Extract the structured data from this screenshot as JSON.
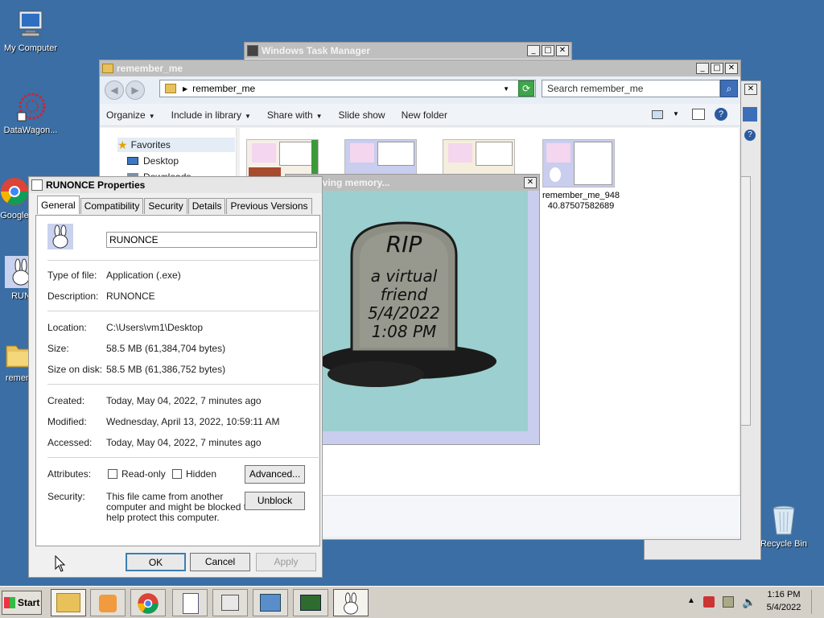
{
  "desktop": {
    "icons": [
      {
        "label": "My Computer"
      },
      {
        "label": "DataWagon..."
      },
      {
        "label": "Google"
      },
      {
        "label": "RUN"
      },
      {
        "label": "remem"
      },
      {
        "label": "Recycle Bin"
      }
    ]
  },
  "task_manager": {
    "title": "Windows Task Manager"
  },
  "explorer": {
    "title": "remember_me",
    "address": "remember_me",
    "search_placeholder": "Search remember_me",
    "commands": [
      {
        "label": "Organize"
      },
      {
        "label": "Include in library"
      },
      {
        "label": "Share with"
      },
      {
        "label": "Slide show"
      },
      {
        "label": "New folder"
      }
    ],
    "nav": {
      "favorites": "Favorites",
      "desktop": "Desktop",
      "downloads": "Downloads"
    },
    "file": {
      "name": "remember_me_948\n40.87507582689"
    }
  },
  "popup": {
    "title": "In loving memory...",
    "rip": "RIP",
    "line1": "a virtual",
    "line2": "friend",
    "date": "5/4/2022",
    "time": "1:08 PM"
  },
  "properties": {
    "title": "RUNONCE Properties",
    "tabs": [
      {
        "label": "General"
      },
      {
        "label": "Compatibility"
      },
      {
        "label": "Security"
      },
      {
        "label": "Details"
      },
      {
        "label": "Previous Versions"
      }
    ],
    "name": "RUNONCE",
    "type_label": "Type of file:",
    "type_value": "Application (.exe)",
    "desc_label": "Description:",
    "desc_value": "RUNONCE",
    "location_label": "Location:",
    "location_value": "C:\\Users\\vm1\\Desktop",
    "size_label": "Size:",
    "size_value": "58.5 MB (61,384,704 bytes)",
    "disk_label": "Size on disk:",
    "disk_value": "58.5 MB (61,386,752 bytes)",
    "created_label": "Created:",
    "created_value": "Today, May 04, 2022, 7 minutes ago",
    "modified_label": "Modified:",
    "modified_value": "Wednesday, April 13, 2022, 10:59:11 AM",
    "accessed_label": "Accessed:",
    "accessed_value": "Today, May 04, 2022, 7 minutes ago",
    "attributes_label": "Attributes:",
    "readonly_label": "Read-only",
    "hidden_label": "Hidden",
    "advanced_label": "Advanced...",
    "security_label": "Security:",
    "security_text1": "This file came from another",
    "security_text2": "computer and might be blocked to",
    "security_text3": "help protect this computer.",
    "unblock_label": "Unblock",
    "ok_label": "OK",
    "cancel_label": "Cancel",
    "apply_label": "Apply"
  },
  "taskbar": {
    "start_label": "Start",
    "time": "1:16 PM",
    "date": "5/4/2022"
  }
}
